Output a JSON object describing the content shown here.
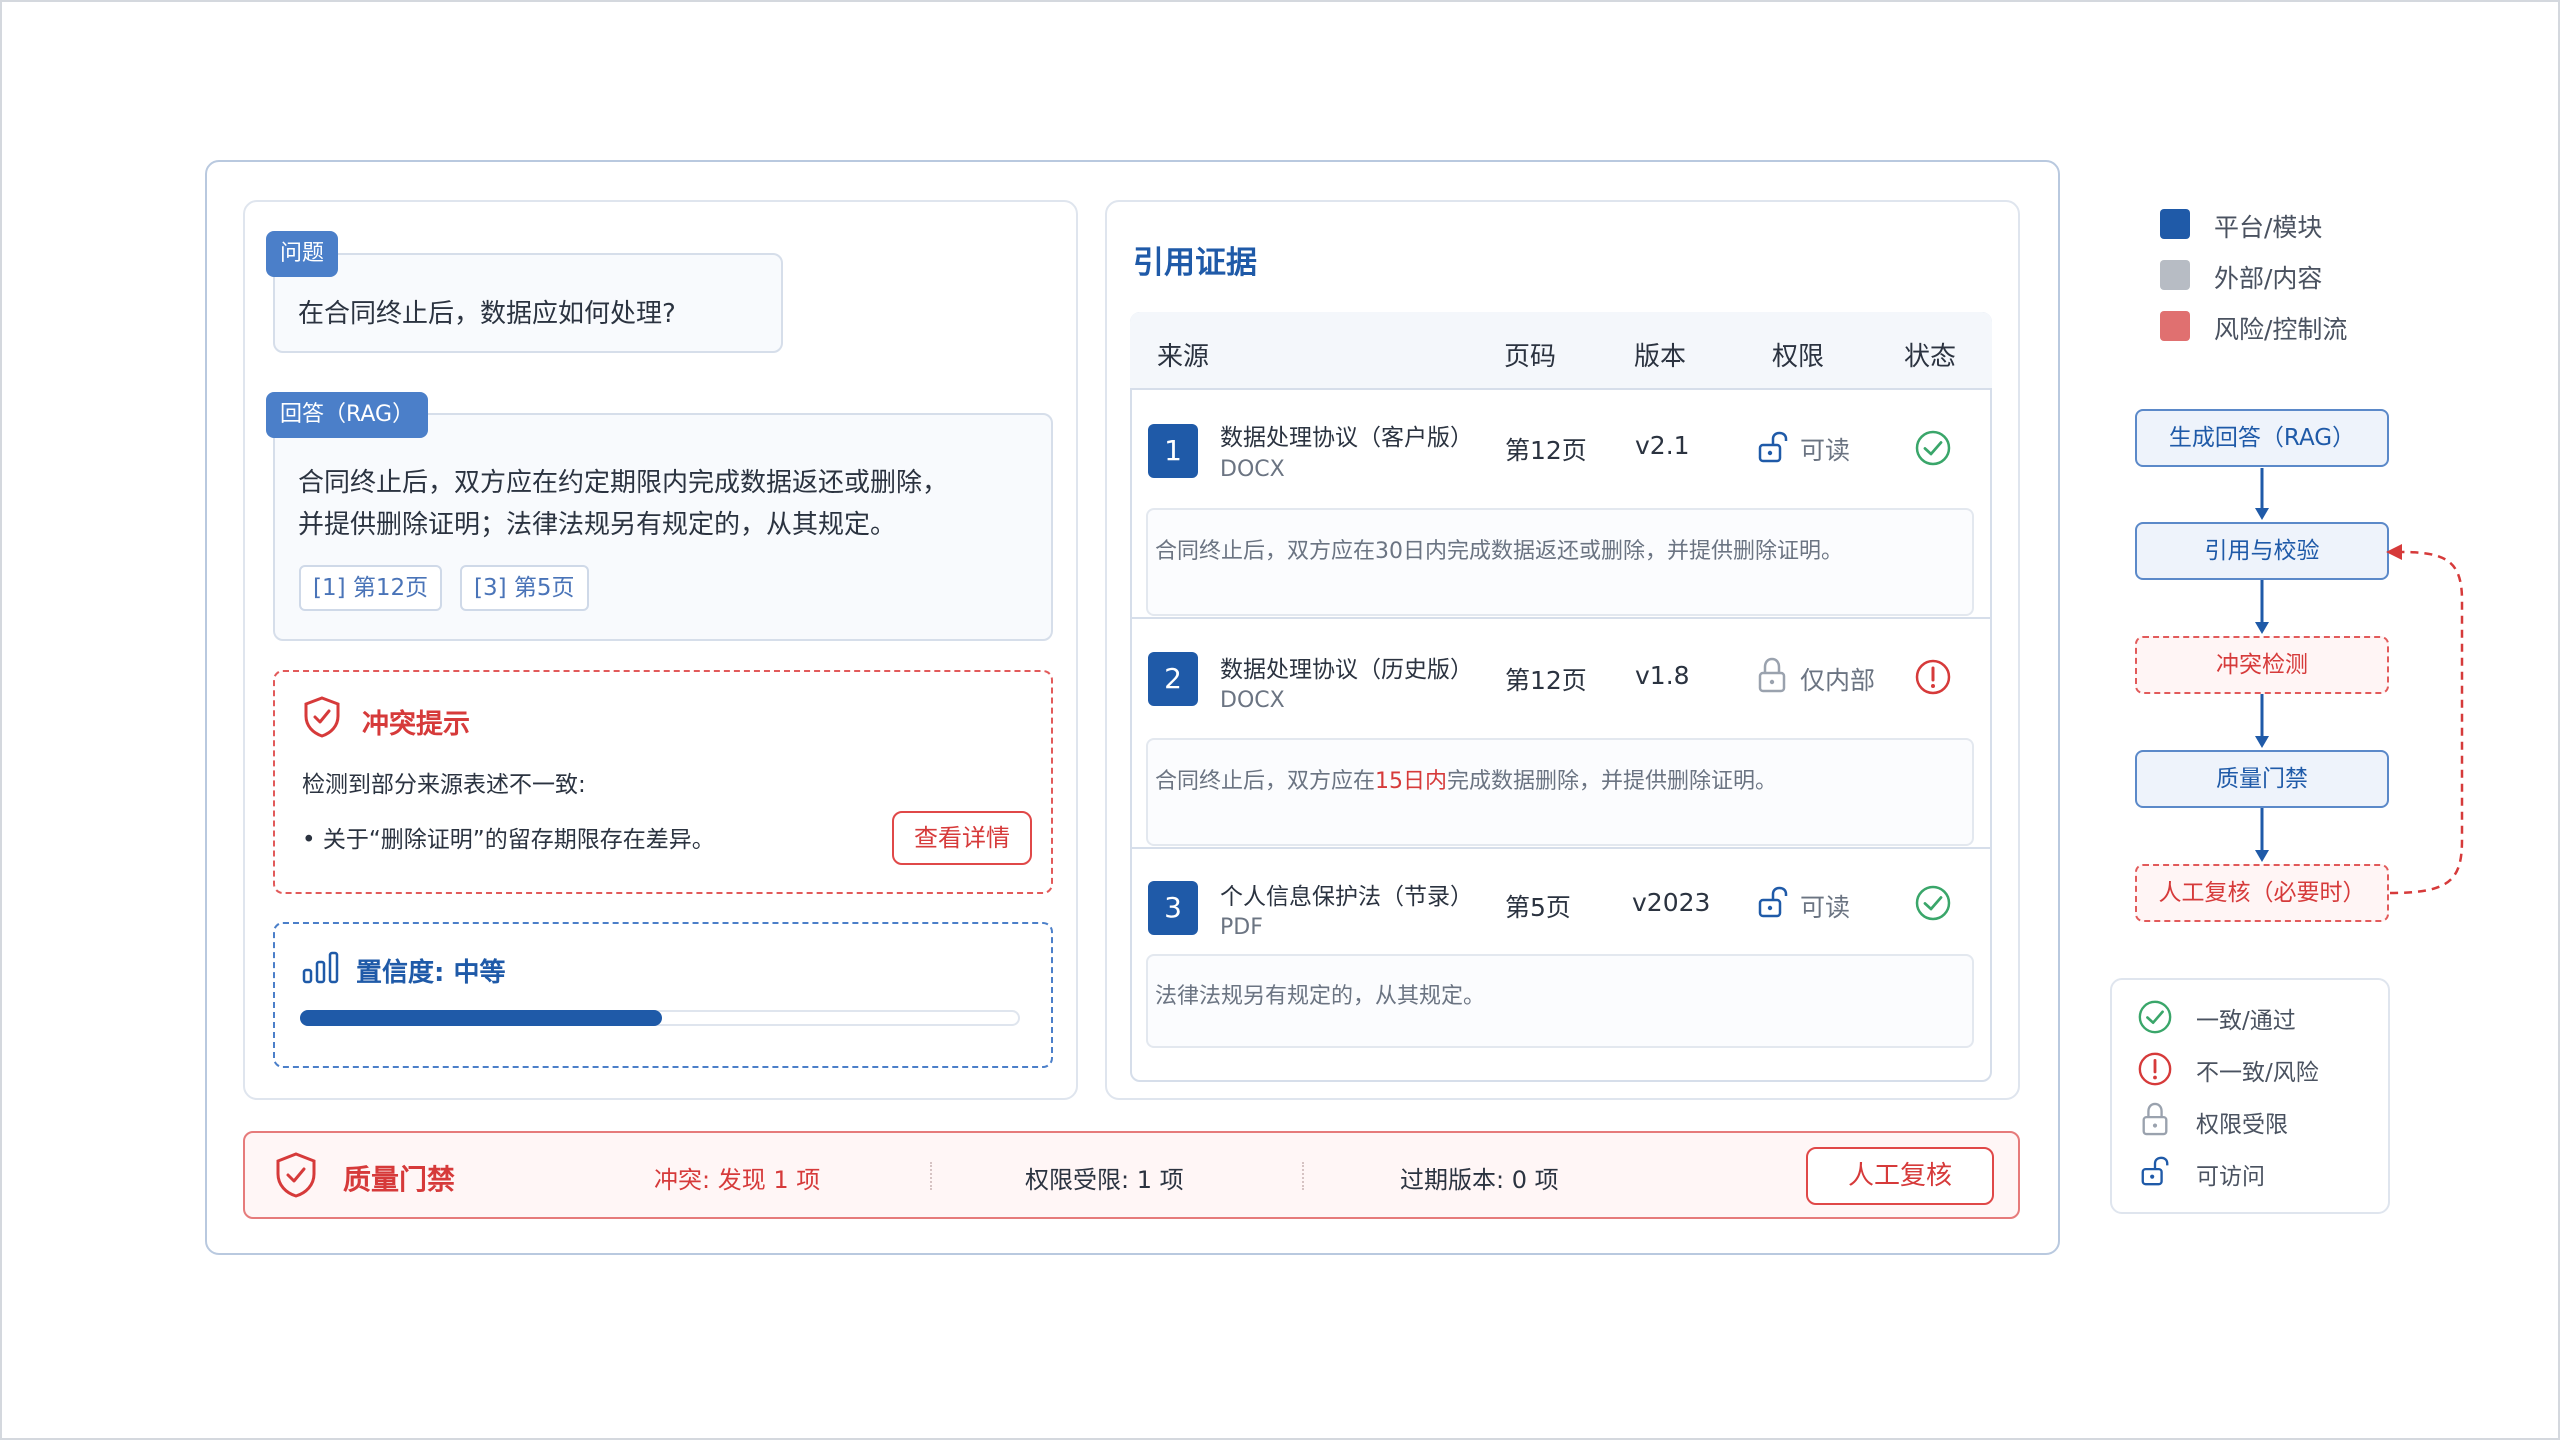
{
  "question": {
    "tag": "问题",
    "text": "在合同终止后，数据应如何处理?"
  },
  "answer": {
    "tag": "回答（RAG）",
    "line1": "合同终止后，双方应在约定期限内完成数据返还或删除，",
    "line2": "并提供删除证明；法律法规另有规定的，从其规定。",
    "citations": [
      "[1] 第12页",
      "[3] 第5页"
    ]
  },
  "conflict": {
    "title": "冲突提示",
    "desc": "检测到部分来源表述不一致:",
    "bullet": "•  关于“删除证明”的留存期限存在差异。",
    "details_button": "查看详情"
  },
  "confidence": {
    "label": "置信度: 中等",
    "level": 0.5
  },
  "evidence": {
    "title": "引用证据",
    "headers": {
      "source": "来源",
      "page": "页码",
      "version": "版本",
      "permission": "权限",
      "status": "状态"
    },
    "rows": [
      {
        "num": "1",
        "title": "数据处理协议（客户版）",
        "type": "DOCX",
        "page": "第12页",
        "version": "v2.1",
        "permission": "可读",
        "permission_icon": "unlock-icon",
        "status": "一致/通过",
        "status_icon": "check-circle-icon",
        "snippet": "合同终止后，双方应在30日内完成数据返还或删除，并提供删除证明。"
      },
      {
        "num": "2",
        "title": "数据处理协议（历史版）",
        "type": "DOCX",
        "page": "第12页",
        "version": "v1.8",
        "permission": "仅内部",
        "permission_icon": "lock-icon",
        "status": "不一致/风险",
        "status_icon": "alert-circle-icon",
        "snippet_pre": "合同终止后，双方应在",
        "snippet_hl": "15日内",
        "snippet_post": "完成数据删除，并提供删除证明。"
      },
      {
        "num": "3",
        "title": "个人信息保护法（节录）",
        "type": "PDF",
        "page": "第5页",
        "version": "v2023",
        "permission": "可读",
        "permission_icon": "unlock-icon",
        "status": "一致/通过",
        "status_icon": "check-circle-icon",
        "snippet": "法律法规另有规定的，从其规定。"
      }
    ]
  },
  "quality_gate": {
    "title": "质量门禁",
    "conflict": "冲突: 发现 1 项",
    "permission": "权限受限: 1 项",
    "expired": "过期版本: 0 项",
    "review_button": "人工复核"
  },
  "legend": [
    {
      "label": "平台/模块",
      "color": "#1f5aa8"
    },
    {
      "label": "外部/内容",
      "color": "#b7bcc4"
    },
    {
      "label": "风险/控制流",
      "color": "#e07070"
    }
  ],
  "flow": [
    "生成回答（RAG）",
    "引用与校验",
    "冲突检测",
    "质量门禁",
    "人工复核（必要时）"
  ],
  "status_legend": [
    {
      "label": "一致/通过",
      "icon": "check-circle-icon"
    },
    {
      "label": "不一致/风险",
      "icon": "alert-circle-icon"
    },
    {
      "label": "权限受限",
      "icon": "lock-icon"
    },
    {
      "label": "可访问",
      "icon": "unlock-icon"
    }
  ],
  "colors": {
    "primary": "#1f5aa8",
    "danger": "#d63a3a",
    "success": "#3aa66a",
    "muted": "#6b7482"
  }
}
